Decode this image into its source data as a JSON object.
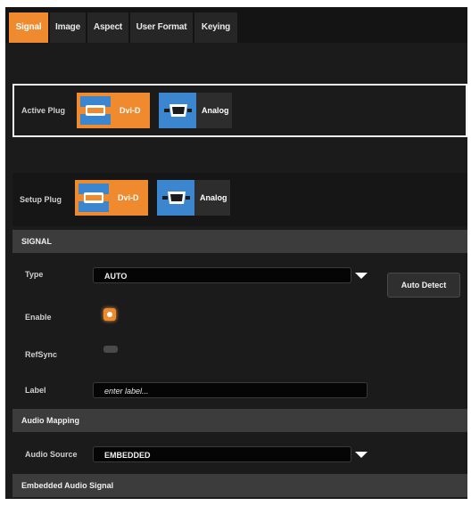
{
  "tabs": [
    {
      "label": "Signal",
      "active": true
    },
    {
      "label": "Image",
      "active": false
    },
    {
      "label": "Aspect",
      "active": false
    },
    {
      "label": "User Format",
      "active": false
    },
    {
      "label": "Keying",
      "active": false
    }
  ],
  "active_plug": {
    "label": "Active Plug",
    "options": [
      {
        "label": "Dvi-D",
        "icon": "dvi-connector-icon",
        "selected": true
      },
      {
        "label": "Analog",
        "icon": "vga-connector-icon",
        "selected": false
      }
    ]
  },
  "setup_plug": {
    "label": "Setup Plug",
    "options": [
      {
        "label": "Dvi-D",
        "icon": "dvi-connector-icon",
        "selected": true
      },
      {
        "label": "Analog",
        "icon": "vga-connector-icon",
        "selected": false
      }
    ]
  },
  "signal_section": {
    "title": "SIGNAL",
    "type_label": "Type",
    "type_value": "AUTO",
    "auto_detect_label": "Auto Detect",
    "enable_label": "Enable",
    "enable_on": true,
    "refsync_label": "RefSync",
    "refsync_on": false,
    "label_label": "Label",
    "label_placeholder": "enter label..."
  },
  "audio_mapping": {
    "title": "Audio Mapping",
    "source_label": "Audio Source",
    "source_value": "EMBEDDED"
  },
  "embedded_audio": {
    "title": "Embedded Audio Signal"
  },
  "colors": {
    "accent": "#f08a2e",
    "connector_blue": "#3b86cf",
    "panel_bg": "#1b1b1b",
    "section_bg": "#3c3c3c"
  }
}
